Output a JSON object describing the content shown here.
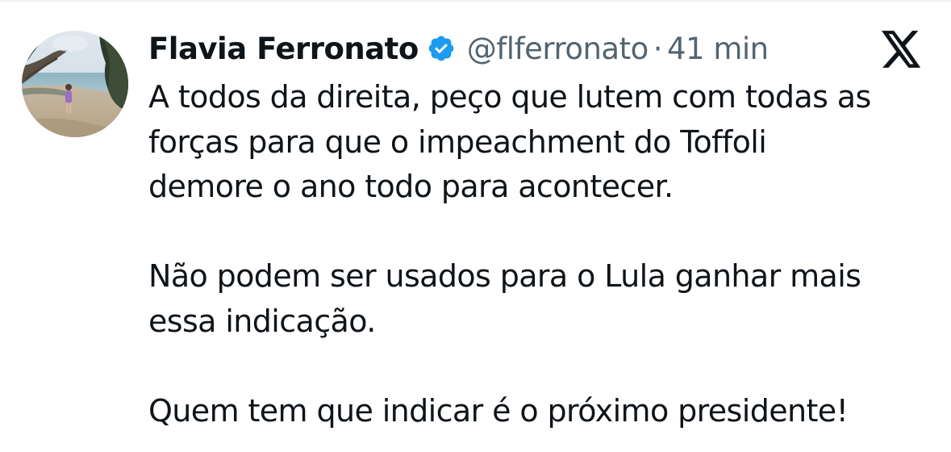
{
  "tweet": {
    "author": {
      "display_name": "Flavia Ferronato",
      "handle": "@flferronato",
      "verified": true,
      "avatar": "profile photo: person standing on a beach with trees and sea"
    },
    "separator": "·",
    "time": "41 min",
    "platform_icon": "x-logo-icon",
    "text": {
      "p1_line1": "A todos da direita, peço que lutem com todas as",
      "p1_line2": "forças para que o impeachment do Toffoli",
      "p1_line3": "demore o ano todo para acontecer.",
      "p2_line1": "Não podem ser usados para o Lula ganhar mais",
      "p2_line2": "essa indicação.",
      "p3_line1": "Quem tem que indicar é o próximo presidente!"
    }
  },
  "colors": {
    "text": "#0f1419",
    "secondary": "#536471",
    "verified_blue": "#1d9bf0",
    "background": "#ffffff"
  }
}
